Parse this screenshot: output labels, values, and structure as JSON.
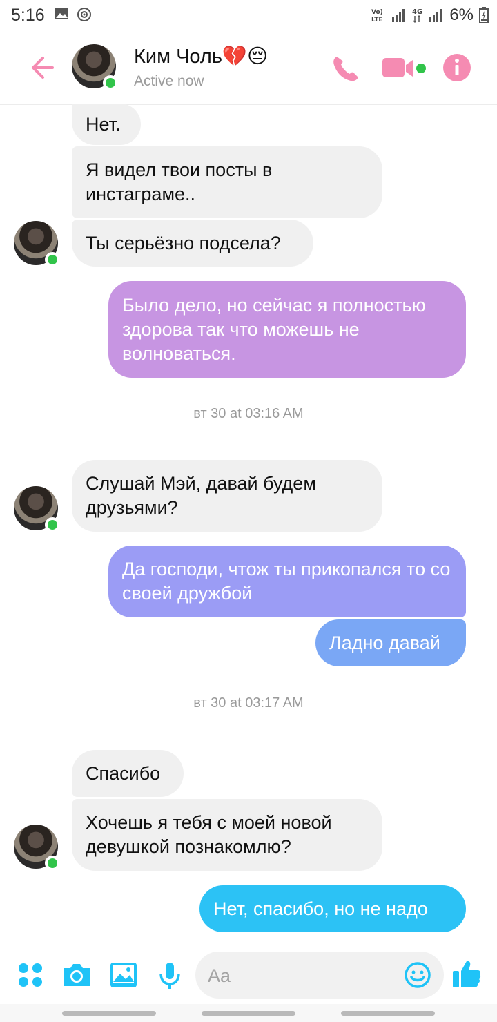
{
  "status_bar": {
    "time": "5:16",
    "battery": "6%",
    "network_labels": [
      "Vo) LTE",
      "4G"
    ]
  },
  "header": {
    "name": "Ким Чоль💔😔",
    "status": "Active now",
    "accent_color": "#f58bb2"
  },
  "messages": [
    {
      "type": "received",
      "text": "Нет."
    },
    {
      "type": "received",
      "text": "Я видел твои посты в инстаграме.."
    },
    {
      "type": "received",
      "text": "Ты серьёзно подсела?"
    },
    {
      "type": "sent",
      "text": "Было дело, но сейчас я полностью здорова так что можешь не волноваться.",
      "color": "#c795e2"
    },
    {
      "type": "timestamp",
      "text": "вт 30 at 03:16 AM"
    },
    {
      "type": "received",
      "text": "Слушай Мэй, давай будем друзьями?"
    },
    {
      "type": "sent",
      "text": "Да господи, чтож ты прикопался то со своей дружбой",
      "color": "#9b9cf5"
    },
    {
      "type": "sent",
      "text": "Ладно давай",
      "color": "#7aa7f5"
    },
    {
      "type": "timestamp",
      "text": "вт 30 at 03:17 AM"
    },
    {
      "type": "received",
      "text": "Спасибо"
    },
    {
      "type": "received",
      "text": "Хочешь я тебя с моей новой девушкой познакомлю?"
    },
    {
      "type": "sent",
      "text": "Нет, спасибо, но не надо",
      "color": "#2cc2f5"
    }
  ],
  "composer": {
    "placeholder": "Aa",
    "icons": [
      "menu-dots-icon",
      "camera-icon",
      "image-icon",
      "microphone-icon",
      "emoji-icon",
      "thumbs-up-icon"
    ],
    "accent_color": "#1fc3f7"
  }
}
